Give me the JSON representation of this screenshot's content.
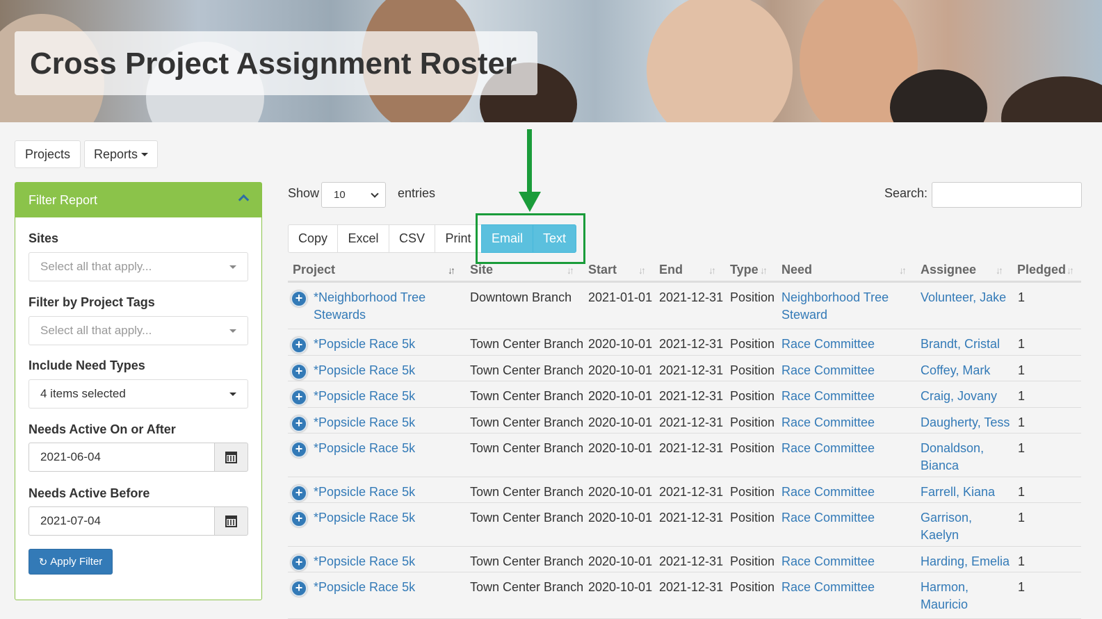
{
  "banner": {
    "title": "Cross Project Assignment Roster"
  },
  "nav": {
    "projects": "Projects",
    "reports": "Reports"
  },
  "filter": {
    "heading": "Filter Report",
    "sites_label": "Sites",
    "sites_placeholder": "Select all that apply...",
    "tags_label": "Filter by Project Tags",
    "tags_placeholder": "Select all that apply...",
    "need_types_label": "Include Need Types",
    "need_types_value": "4 items selected",
    "after_label": "Needs Active On or After",
    "after_value": "2021-06-04",
    "before_label": "Needs Active Before",
    "before_value": "2021-07-04",
    "apply_label": "Apply Filter"
  },
  "controls": {
    "show_label": "Show",
    "entries_value": "10",
    "entries_label": "entries",
    "search_label": "Search:"
  },
  "toolbar": {
    "copy": "Copy",
    "excel": "Excel",
    "csv": "CSV",
    "print": "Print",
    "email": "Email",
    "text": "Text"
  },
  "table": {
    "columns": [
      "Project",
      "Site",
      "Start",
      "End",
      "Type",
      "Need",
      "Assignee",
      "Pledged"
    ],
    "rows": [
      {
        "project": "*Neighborhood Tree Stewards",
        "site": "Downtown Branch",
        "start": "2021-01-01",
        "end": "2021-12-31",
        "type": "Position",
        "need": "Neighborhood Tree Steward",
        "assignee": "Volunteer, Jake",
        "pledged": "1"
      },
      {
        "project": "*Popsicle Race 5k",
        "site": "Town Center Branch",
        "start": "2020-10-01",
        "end": "2021-12-31",
        "type": "Position",
        "need": "Race Committee",
        "assignee": "Brandt, Cristal",
        "pledged": "1"
      },
      {
        "project": "*Popsicle Race 5k",
        "site": "Town Center Branch",
        "start": "2020-10-01",
        "end": "2021-12-31",
        "type": "Position",
        "need": "Race Committee",
        "assignee": "Coffey, Mark",
        "pledged": "1"
      },
      {
        "project": "*Popsicle Race 5k",
        "site": "Town Center Branch",
        "start": "2020-10-01",
        "end": "2021-12-31",
        "type": "Position",
        "need": "Race Committee",
        "assignee": "Craig, Jovany",
        "pledged": "1"
      },
      {
        "project": "*Popsicle Race 5k",
        "site": "Town Center Branch",
        "start": "2020-10-01",
        "end": "2021-12-31",
        "type": "Position",
        "need": "Race Committee",
        "assignee": "Daugherty, Tess",
        "pledged": "1"
      },
      {
        "project": "*Popsicle Race 5k",
        "site": "Town Center Branch",
        "start": "2020-10-01",
        "end": "2021-12-31",
        "type": "Position",
        "need": "Race Committee",
        "assignee": "Donaldson, Bianca",
        "pledged": "1"
      },
      {
        "project": "*Popsicle Race 5k",
        "site": "Town Center Branch",
        "start": "2020-10-01",
        "end": "2021-12-31",
        "type": "Position",
        "need": "Race Committee",
        "assignee": "Farrell, Kiana",
        "pledged": "1"
      },
      {
        "project": "*Popsicle Race 5k",
        "site": "Town Center Branch",
        "start": "2020-10-01",
        "end": "2021-12-31",
        "type": "Position",
        "need": "Race Committee",
        "assignee": "Garrison, Kaelyn",
        "pledged": "1"
      },
      {
        "project": "*Popsicle Race 5k",
        "site": "Town Center Branch",
        "start": "2020-10-01",
        "end": "2021-12-31",
        "type": "Position",
        "need": "Race Committee",
        "assignee": "Harding, Emelia",
        "pledged": "1"
      },
      {
        "project": "*Popsicle Race 5k",
        "site": "Town Center Branch",
        "start": "2020-10-01",
        "end": "2021-12-31",
        "type": "Position",
        "need": "Race Committee",
        "assignee": "Harmon, Mauricio",
        "pledged": "1"
      }
    ]
  },
  "colors": {
    "filter_green": "#8bc34a",
    "primary_blue": "#337ab7",
    "info_blue": "#5bc0de",
    "annotation_green": "#1a9c3a"
  }
}
